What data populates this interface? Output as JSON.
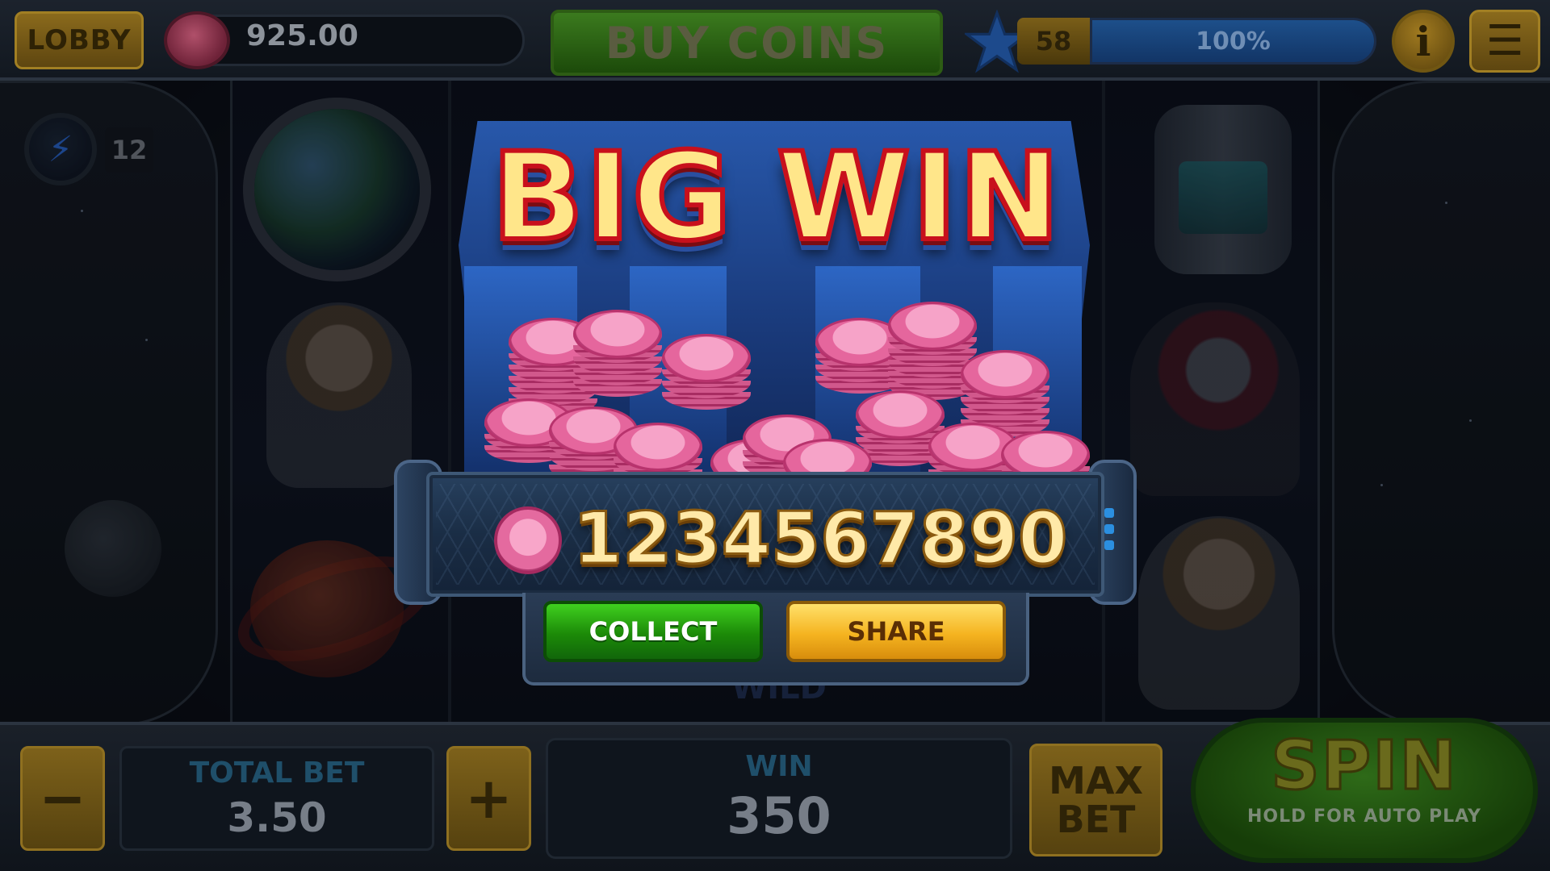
{
  "top_bar": {
    "lobby_label": "LOBBY",
    "balance": "925.00",
    "buy_coins_label": "BUY COINS",
    "level": "58",
    "xp_progress_percent": 100,
    "xp_label": "100%",
    "info_label": "i",
    "menu_label": "☰"
  },
  "side": {
    "free_spins_icon": "lightning-icon",
    "free_spins_count": "12"
  },
  "popup": {
    "title": "BIG WIN",
    "amount": "1234567890",
    "collect_label": "COLLECT",
    "share_label": "SHARE"
  },
  "reels": {
    "wild_label": "WILD"
  },
  "bottom_bar": {
    "minus_label": "−",
    "plus_label": "+",
    "total_bet_label": "TOTAL BET",
    "total_bet_value": "3.50",
    "win_label": "WIN",
    "win_value": "350",
    "max_bet_label": "MAX BET",
    "spin_label": "SPIN",
    "spin_sub_label": "HOLD FOR AUTO PLAY"
  },
  "colors": {
    "coin_pink": "#e5669d",
    "title_yellow": "#ffe68a",
    "title_outline": "#c8101c",
    "collect_green": "#1c8a08",
    "share_gold": "#f5b420"
  }
}
